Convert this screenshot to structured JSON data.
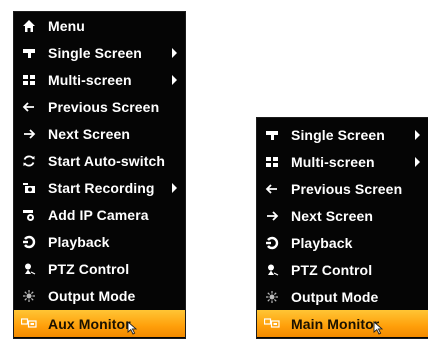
{
  "left_menu": {
    "items": [
      {
        "label": "Menu",
        "icon": "home-icon",
        "has_submenu": false
      },
      {
        "label": "Single Screen",
        "icon": "single-screen-icon",
        "has_submenu": true
      },
      {
        "label": "Multi-screen",
        "icon": "multi-screen-icon",
        "has_submenu": true
      },
      {
        "label": "Previous Screen",
        "icon": "arrow-left-icon",
        "has_submenu": false
      },
      {
        "label": "Next Screen",
        "icon": "arrow-right-icon",
        "has_submenu": false
      },
      {
        "label": "Start Auto-switch",
        "icon": "auto-switch-icon",
        "has_submenu": false
      },
      {
        "label": "Start Recording",
        "icon": "recording-icon",
        "has_submenu": true
      },
      {
        "label": "Add IP Camera",
        "icon": "ip-camera-icon",
        "has_submenu": false
      },
      {
        "label": "Playback",
        "icon": "playback-icon",
        "has_submenu": false
      },
      {
        "label": "PTZ Control",
        "icon": "ptz-icon",
        "has_submenu": false
      },
      {
        "label": "Output Mode",
        "icon": "output-mode-icon",
        "has_submenu": false
      },
      {
        "label": "Aux Monitor",
        "icon": "monitor-icon",
        "has_submenu": false,
        "selected": true
      }
    ]
  },
  "right_menu": {
    "items": [
      {
        "label": "Single Screen",
        "icon": "single-screen-icon",
        "has_submenu": true
      },
      {
        "label": "Multi-screen",
        "icon": "multi-screen-icon",
        "has_submenu": true
      },
      {
        "label": "Previous Screen",
        "icon": "arrow-left-icon",
        "has_submenu": false
      },
      {
        "label": "Next Screen",
        "icon": "arrow-right-icon",
        "has_submenu": false
      },
      {
        "label": "Playback",
        "icon": "playback-icon",
        "has_submenu": false
      },
      {
        "label": "PTZ Control",
        "icon": "ptz-icon",
        "has_submenu": false
      },
      {
        "label": "Output Mode",
        "icon": "output-mode-icon",
        "has_submenu": false
      },
      {
        "label": "Main Monitor",
        "icon": "monitor-icon",
        "has_submenu": false,
        "selected": true
      }
    ]
  },
  "colors": {
    "menu_background": "#050505",
    "text": "#ffffff",
    "selected_highlight": "#ffa820",
    "selected_text": "#1a1100"
  }
}
